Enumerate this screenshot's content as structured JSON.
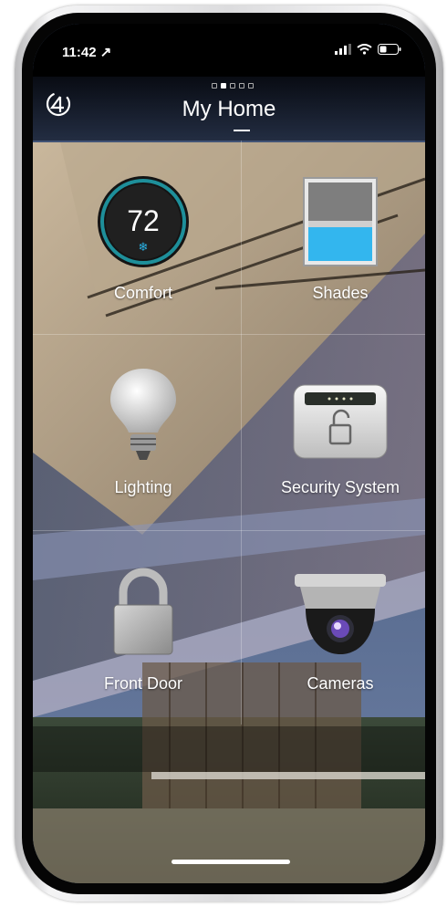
{
  "status": {
    "time": "11:42 ↗"
  },
  "header": {
    "title": "My Home",
    "pages": 5,
    "active_page": 1
  },
  "tiles": [
    {
      "label": "Comfort",
      "temperature": "72"
    },
    {
      "label": "Shades"
    },
    {
      "label": "Lighting"
    },
    {
      "label": "Security System"
    },
    {
      "label": "Front Door"
    },
    {
      "label": "Cameras"
    }
  ],
  "icons": {
    "logo": "control4-logo-icon",
    "signal": "cellular-signal-icon",
    "wifi": "wifi-icon",
    "battery": "battery-icon"
  },
  "colors": {
    "accent": "#2ab4e8",
    "thermostat_ring": "#1e8f9a"
  }
}
